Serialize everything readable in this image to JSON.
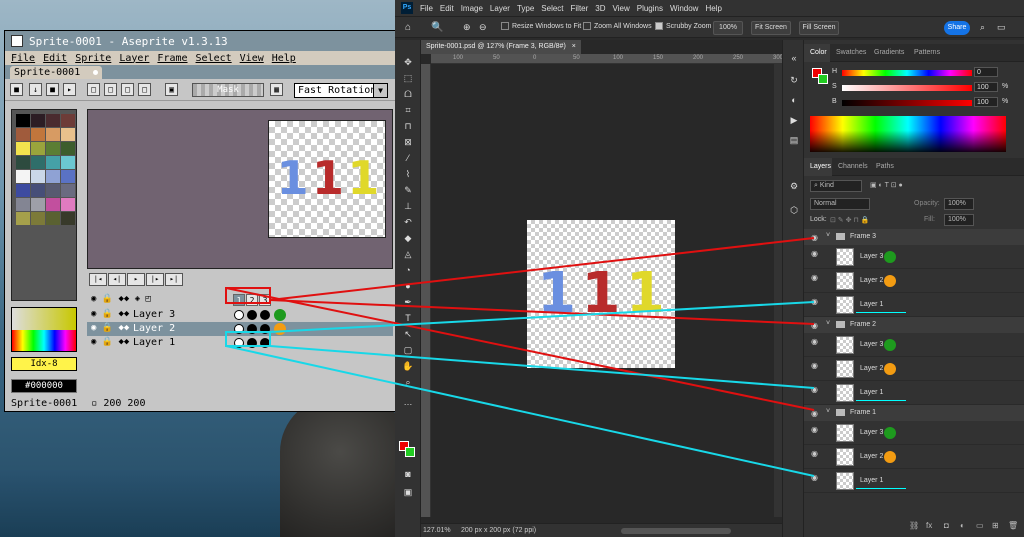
{
  "aseprite": {
    "title": "Sprite-0001 - Aseprite v1.3.13",
    "menu": [
      "File",
      "Edit",
      "Sprite",
      "Layer",
      "Frame",
      "Select",
      "View",
      "Help"
    ],
    "tab": "Sprite-0001",
    "mask_button": "Mask",
    "rotation_select": "Fast Rotation",
    "palette_colors": [
      "#000000",
      "#2c1d24",
      "#4a2b2f",
      "#6d3c38",
      "#a05b3c",
      "#c1763c",
      "#d79b63",
      "#e8c18c",
      "#f2e34e",
      "#9aa43c",
      "#5b7e34",
      "#3d5d2c",
      "#2d4b3f",
      "#2f6e6a",
      "#45a1a7",
      "#6bc7d1",
      "#f4f4f4",
      "#cad7e8",
      "#8fa2d4",
      "#5a72c4",
      "#3d4ba0",
      "#464e78",
      "#585a70",
      "#6a6b80",
      "#838593",
      "#9e9fa8",
      "#c24f9e",
      "#e07bc0",
      "#a5a04b",
      "#7c7a39",
      "#5a6131",
      "#383a2a"
    ],
    "fg_index": "Idx-8",
    "hex_value": "#000000",
    "timeline": {
      "frame_numbers": [
        "1",
        "2",
        "3"
      ],
      "layers": [
        {
          "name": "Layer 3",
          "dot_color": "#1e9a1e"
        },
        {
          "name": "Layer 2",
          "dot_color": "#f39c12"
        },
        {
          "name": "Layer 1",
          "dot_color": ""
        }
      ]
    },
    "status": "Sprite-0001",
    "size": "200 200",
    "canvas_digits": [
      {
        "char": "1",
        "color": "#6a8fe0"
      },
      {
        "char": "1",
        "color": "#b82b2b"
      },
      {
        "char": "1",
        "color": "#e0d82a"
      }
    ]
  },
  "photoshop": {
    "menu": [
      "File",
      "Edit",
      "Image",
      "Layer",
      "Type",
      "Select",
      "Filter",
      "3D",
      "View",
      "Plugins",
      "Window",
      "Help"
    ],
    "options": {
      "resize_windows": "Resize Windows to Fit",
      "zoom_all": "Zoom All Windows",
      "scrubby": "Scrubby Zoom",
      "zoom_value": "100%",
      "fit_screen": "Fit Screen",
      "fill_screen": "Fill Screen",
      "share": "Share"
    },
    "doc_tab": "Sprite-0001.psd @ 127% (Frame 3, RGB/8#)",
    "ruler_marks": [
      "100",
      "50",
      "0",
      "50",
      "100",
      "150",
      "200",
      "250",
      "300"
    ],
    "status_zoom": "127.01%",
    "status_size": "200 px x 200 px (72 ppi)",
    "color_tabs": [
      "Color",
      "Swatches",
      "Gradients",
      "Patterns"
    ],
    "sliders": [
      {
        "label": "H",
        "value": "0",
        "unit": ""
      },
      {
        "label": "S",
        "value": "100",
        "unit": "%"
      },
      {
        "label": "B",
        "value": "100",
        "unit": "%"
      }
    ],
    "layer_tabs": [
      "Layers",
      "Channels",
      "Paths"
    ],
    "kind": "Kind",
    "blend_mode": "Normal",
    "opacity_label": "Opacity:",
    "opacity_value": "100%",
    "lock_label": "Lock:",
    "fill_label": "Fill:",
    "fill_value": "100%",
    "groups": [
      {
        "name": "Frame 3",
        "layers": [
          {
            "name": "Layer 3",
            "dot": "#1e9a1e"
          },
          {
            "name": "Layer 2",
            "dot": "#f39c12"
          },
          {
            "name": "Layer 1",
            "dot": ""
          }
        ]
      },
      {
        "name": "Frame 2",
        "layers": [
          {
            "name": "Layer 3",
            "dot": "#1e9a1e"
          },
          {
            "name": "Layer 2",
            "dot": "#f39c12"
          },
          {
            "name": "Layer 1",
            "dot": ""
          }
        ]
      },
      {
        "name": "Frame 1",
        "layers": [
          {
            "name": "Layer 3",
            "dot": "#1e9a1e"
          },
          {
            "name": "Layer 2",
            "dot": "#f39c12"
          },
          {
            "name": "Layer 1",
            "dot": ""
          }
        ]
      }
    ]
  },
  "colors": {
    "annotation_red": "#e01010",
    "annotation_cyan": "#18d8e8"
  }
}
